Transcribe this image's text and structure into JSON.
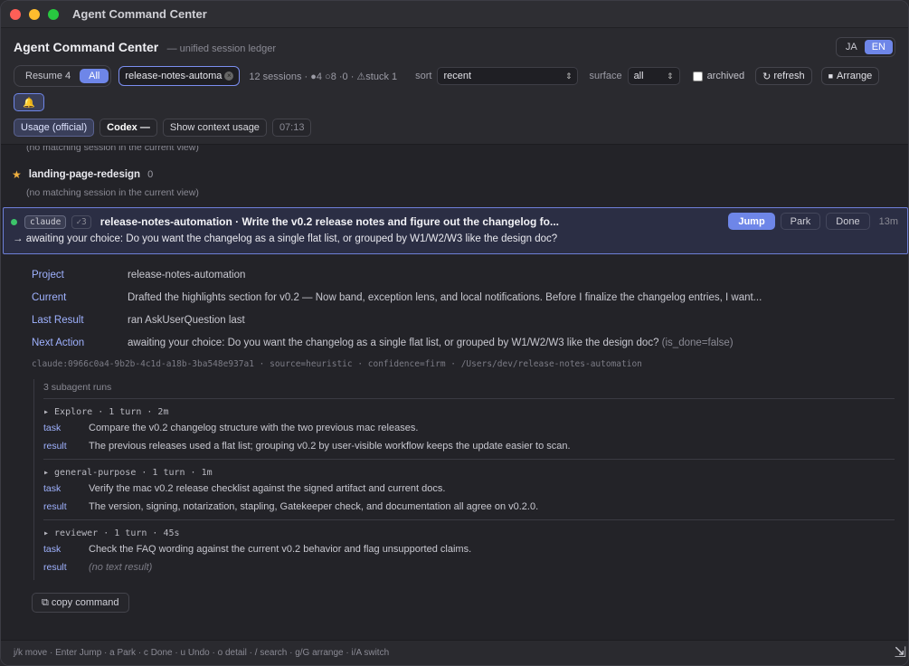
{
  "window": {
    "title": "Agent Command Center"
  },
  "header": {
    "title": "Agent Command Center",
    "subtitle": "— unified session ledger",
    "lang": [
      "JA",
      "EN"
    ]
  },
  "toolbar": {
    "resume": "Resume 4",
    "all": "All",
    "search_value": "release-notes-automa",
    "stats": "12 sessions · ●4 ○8 ·0 · ⚠stuck 1",
    "sort_label": "sort",
    "sort_value": "recent",
    "surface_label": "surface",
    "surface_value": "all",
    "archived_label": "archived",
    "refresh": "refresh",
    "arrange": "Arrange",
    "bell": "🔔",
    "usage": "Usage (official)",
    "codex": "Codex —",
    "show_context": "Show context usage",
    "time": "07:13"
  },
  "content": {
    "nomatch_top": "(no matching session in the current view)",
    "group": {
      "name": "landing-page-redesign",
      "count": "0"
    },
    "nomatch": "(no matching session in the current view)",
    "session": {
      "tag": "claude",
      "tag2": "✓3",
      "title": "release-notes-automation · Write the v0.2 release notes and figure out the changelog fo...",
      "actions": {
        "jump": "Jump",
        "park": "Park",
        "done": "Done"
      },
      "age": "13m",
      "line2": "→ awaiting your choice: Do you want the changelog as a single flat list, or grouped by W1/W2/W3 like the design doc?"
    },
    "details": {
      "project_k": "Project",
      "project_v": "release-notes-automation",
      "current_k": "Current",
      "current_v": "Drafted the highlights section for v0.2 — Now band, exception lens, and local notifications. Before I finalize the changelog entries, I want...",
      "last_k": "Last Result",
      "last_v": "ran AskUserQuestion last",
      "next_k": "Next Action",
      "next_v": "awaiting your choice: Do you want the changelog as a single flat list, or grouped by W1/W2/W3 like the design doc?",
      "next_flag": "(is_done=false)",
      "meta": "claude:0966c0a4-9b2b-4c1d-a18b-3ba548e937a1 · source=heuristic · confidence=firm · /Users/dev/release-notes-automation"
    },
    "subagents": {
      "head": "3 subagent runs",
      "task_k": "task",
      "result_k": "result",
      "runs": [
        {
          "head": "▸ Explore · 1 turn · 2m",
          "task": "Compare the v0.2 changelog structure with the two previous mac releases.",
          "result": "The previous releases used a flat list; grouping v0.2 by user-visible workflow keeps the update easier to scan."
        },
        {
          "head": "▸ general-purpose · 1 turn · 1m",
          "task": "Verify the mac v0.2 release checklist against the signed artifact and current docs.",
          "result": "The version, signing, notarization, stapling, Gatekeeper check, and documentation all agree on v0.2.0."
        },
        {
          "head": "▸ reviewer · 1 turn · 45s",
          "task": "Check the FAQ wording against the current v0.2 behavior and flag unsupported claims.",
          "result": "(no text result)"
        }
      ]
    },
    "copy": "⧉ copy command"
  },
  "status": {
    "hints": "j/k move · Enter Jump · a Park · c Done · u Undo · o detail · / search · g/G arrange · i/A switch"
  },
  "colors": {
    "accent": "#6e86e8",
    "running": "#3cc46a",
    "star": "#f0b040"
  }
}
